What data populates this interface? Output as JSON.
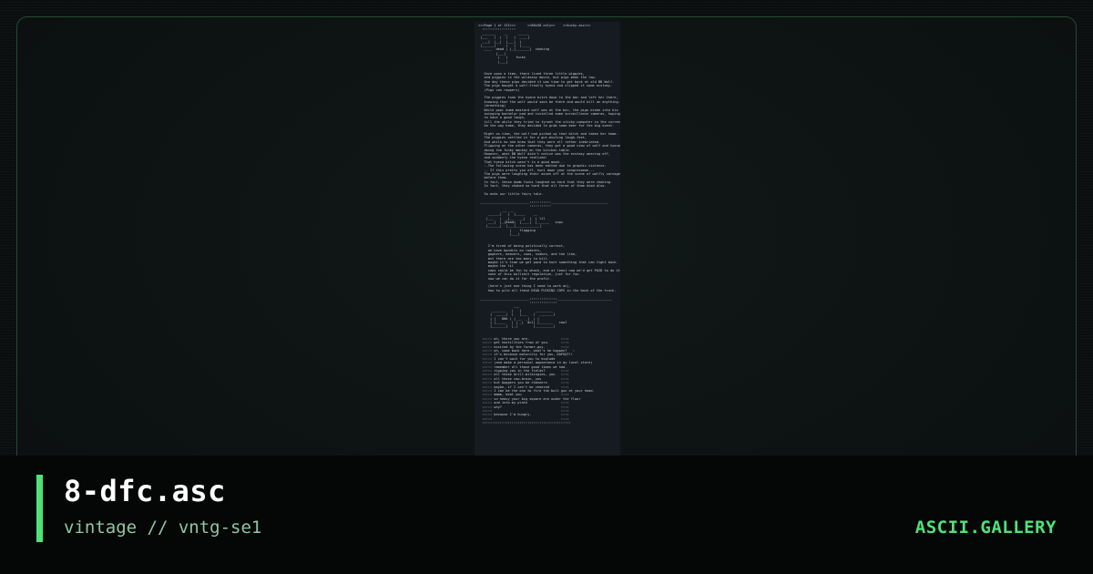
{
  "file": {
    "name": "8-dfc.asc",
    "meta": "vintage // vntg-se1"
  },
  "brand": {
    "label": "ASCII.GALLERY"
  },
  "preview": {
    "art": "<<<Page 1 of III>>>      <<80x50 only>>    <<Sucky.asc>>>\n  :::::::::::::::::\n  _______    __     ______\n |___   |  |  |   |  ____|\n  ___|  |__|  |___|  |\n |______|     |   |  |____\n   ____  dead | |_|_______|  choking\n         |___|\n          |   |    fucks\n          |___|\n\n\n   Once upon a time, there lived three little piggies,\n   and piggies in the wildsany movie, but pigs mean the law.\n   One day these pigs decided it was time to get back at old BB Wolf.\n   The pigs bought a wolf-frontly hyena and slipped it some ecstasy.\n   (Pigs can rappers)\n\n   The piggies took the hyena bitch down to the bar and left her there,\n   knowing that the wolf would soon be there and would kill an anything.\n   (breathing)\n   While poor dumb bastard wolf was at the bar, the pigs broke into his\n   swinging bachelor pad and installed some surveillance cameras, hoping\n   to have a good laugh,\n   till the while they tried to tyrant the sticky-computer in the current.\n   On the way home, they decided to grab some beer for the big event.\n\n   Right on time, the wolf had picked up that bitch and taken her home.\n   The piggies settled in for a gut-busting laugh-fest,\n   And while no one knew that they were all rather inebriated.\n   Flipping on the other cameras, they got a good view of wolf and hyena\n   doing the funky monkey on the kitchen table.\n   However, what BB Wolf didn't notice was the ecstasy wearing off,\n   and suddenly the hyena realized:\n   That hyena bitch wasn't in a good mood...\n   --The following scene has been edited due to graphic violence.\n   -- If this pretty you off, hunt down your congressman.--\n   The pigs were laughing their asses off at the scene of wolfly carnage\n   before them.\n   In fact, these dumb fucks laughed so hard that they were choking.\n   In fact, they choked so hard that all three of them died also.\n\n   So ends our little fairy tale.\n\n _________________________:::::::::::_____________________________\n                          :::::::::::\n            ___ __\n     ______|   |  |_____    __\n    |___   |  _|__   __|  |  | lil\n     ___|  |_|dead|  |____|  |______   cops\n    |______|  |___|____________|\n                |    flogging\n                |___|\n\n\n     I'm tired of being politically correct,\n     we have bandits on rodents,\n     gophers, beavers, cows, snakes, and the like,\n     but there are too many to kill.\n     maybe it's time we get paid to hunt something that can fight back.\n     maybe the lil\n     cops could be fun to whack, and at least now we'd get PAID to do it.\n     none of this bullshit regulation, just for fun.\n     now we can do it for the profit.\n\n     (here's just one thing I need to work on),\n     how to pile all these DEAD FUCKING COPS in the back of the truck.\n\n _________________________::::::::::::::____________________________\n                          ::::::::::::::\n                  ___\n       _______   |   |       _________\n      |  _____|  |   |___   |  _______|\n      | |   KKK ( | __  _|  | |\n      | |_____   | | _|  dcl| |_______   cow?\n      |_______|  |_|        |_________|\n\n\n  ::::: oh, there you are.                ::::\n  ::::: get hostilities from of you.      ::::\n  ::::: excited by the farmer-guy.        ::::\n  ::::: oh, come back here, what's he happen?   :\n  ::::: it's because motorcity for you, DAFUQ?!!\n  ::::: I can't wait for you to explode\n  ::::: (and make a personal appearance in my local store)\n  ::::: remember all those good times we had.\n  ::::: tipping you in the fields?        ::::\n  ::::: all those drill-milkingies, you   ::::\n  ::::: all those cow-brain, you          ::::\n  ::::: but boggers you be chaseers       ::::\n  ::::: maybe, if I can't be cheered      ::::\n  ::::: I can be the one to fire the bolt gun at your head.\n  ::::: mmmm, beat you                    ::::\n  ::::: so heavy your big square are under the floor\n  ::::: and into my plate                 ::::\n  ::::: why?                              ::::\n  :::::                                   ::::\n  ::::: because I'm hungry.               ::::\n  :::::                                   ::::\n  :::::::::::::::::::::::::::::::::::::::::::::"
  }
}
